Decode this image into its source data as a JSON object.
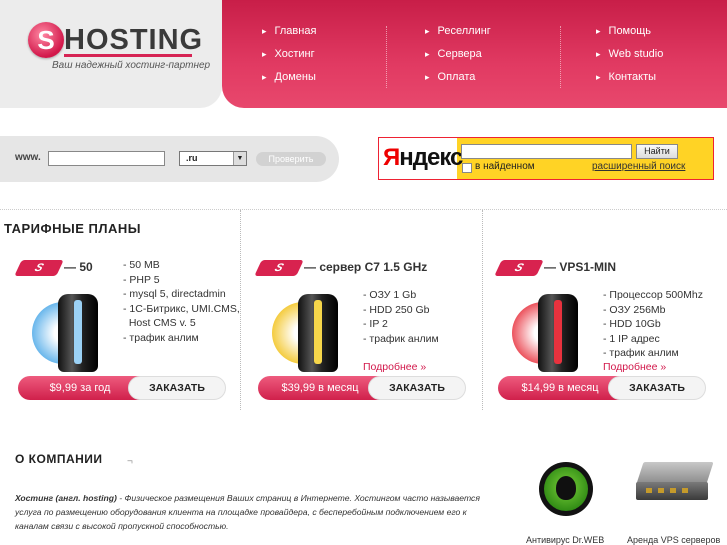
{
  "logo": {
    "letter": "S",
    "word": "HOSTING",
    "tagline": "Ваш надежный хостинг-партнер"
  },
  "nav": {
    "col1": [
      "Главная",
      "Хостинг",
      "Домены"
    ],
    "col2": [
      "Реселлинг",
      "Сервера",
      "Оплата"
    ],
    "col3": [
      "Помощь",
      "Web studio",
      "Контакты"
    ]
  },
  "domain_check": {
    "www_label": "www.",
    "input_value": "",
    "zone_selected": ".ru",
    "button_label": "Проверить"
  },
  "yandex": {
    "logo_first": "Я",
    "logo_rest": "ндекс",
    "input_value": "",
    "button_label": "Найти",
    "checkbox_label": "в найденном",
    "advanced_link": "расширенный поиск"
  },
  "plans": {
    "title": "ТАРИФНЫЕ ПЛАНЫ",
    "items": [
      {
        "badge": "S",
        "name": "— 50",
        "features": [
          "- 50 MB",
          "- PHP 5",
          "- mysql 5, directadmin",
          "- 1С-Битрикс, UMI.CMS,",
          "  Host CMS v. 5",
          "- трафик анлим"
        ],
        "more": "",
        "price": "$9,99 за год",
        "order": "ЗАКАЗАТЬ",
        "accent": "#4da9e8"
      },
      {
        "badge": "S",
        "name": "— сервер С7 1.5 GHz",
        "features": [
          "- ОЗУ 1 Gb",
          "- HDD 250 Gb",
          "- IP 2",
          "- трафик анлим"
        ],
        "more": "Подробнее »",
        "price": "$39,99 в месяц",
        "order": "ЗАКАЗАТЬ",
        "accent": "#f2c21b"
      },
      {
        "badge": "S",
        "name": "— VPS1-MIN",
        "features": [
          "- Процессор 500Mhz",
          "- ОЗУ 256Mb",
          "- HDD 10Gb",
          "- 1 IP адрес",
          "- трафик анлим"
        ],
        "more": "Подробнее »",
        "price": "$14,99 в месяц",
        "order": "ЗАКАЗАТЬ",
        "accent": "#e8323e"
      }
    ]
  },
  "about": {
    "title": "О КОМПАНИИ",
    "mark": "¬",
    "term": "Хостинг (англ. hosting)",
    "text": " - Физическое размещения Ваших страниц в Интернете. Хостингом часто называется услуга по размещению оборудования клиента на площадке провайдера, с бесперебойным подключением его к каналам связи с высокой пропускной способностью."
  },
  "promos": [
    {
      "label": "Антивирус Dr.WEB",
      "icon": "drweb-spider-icon"
    },
    {
      "label": "Аренда VPS серверов",
      "icon": "server-rack-icon"
    }
  ],
  "colors": {
    "brand": "#d62454",
    "nav_bg": "#e13a62",
    "gray": "#ececec"
  }
}
